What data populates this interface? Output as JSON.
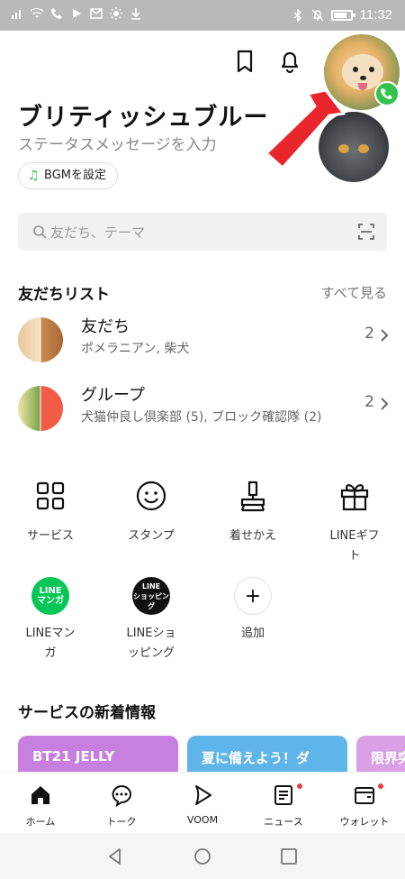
{
  "status_bar": {
    "time": "11:32",
    "battery_level": 0.8
  },
  "profile": {
    "name": "ブリティッシュブルー",
    "status_message": "ステータスメッセージを入力",
    "bgm_label": "BGMを設定"
  },
  "search": {
    "placeholder": "友だち、テーマ"
  },
  "friends_section": {
    "title": "友だちリスト",
    "see_all": "すべて見る",
    "rows": [
      {
        "title": "友だち",
        "subtitle": "ポメラニアン, 柴犬",
        "count": "2"
      },
      {
        "title": "グループ",
        "subtitle": "犬猫仲良し倶楽部 (5), ブロック確認隊 (2)",
        "count": "2"
      }
    ]
  },
  "services": {
    "row1": [
      {
        "icon": "grid-icon",
        "label": "サービス"
      },
      {
        "icon": "smiley-icon",
        "label": "スタンプ"
      },
      {
        "icon": "brush-icon",
        "label": "着せかえ"
      },
      {
        "icon": "gift-icon",
        "label": "LINEギフト"
      }
    ],
    "row2": [
      {
        "icon": "line-manga-icon",
        "badge_text": "LINE\nマンガ",
        "label": "LINEマンガ",
        "color": "#06c755"
      },
      {
        "icon": "line-shopping-icon",
        "badge_text": "LINE\nショッピング",
        "label": "LINEショッピング",
        "color": "#111111"
      },
      {
        "icon": "plus-icon",
        "label": "追加"
      }
    ]
  },
  "news": {
    "title": "サービスの新着情報",
    "cards": [
      {
        "title": "BT21 JELLY",
        "color": "#c77fe0"
      },
      {
        "title": "夏に備えよう！ダ",
        "color": "#5fb4ea"
      },
      {
        "title": "限界突",
        "color": "#d9a0e6"
      }
    ]
  },
  "tab_bar": [
    {
      "icon": "home-icon",
      "label": "ホーム",
      "active": true,
      "notify": false
    },
    {
      "icon": "chat-icon",
      "label": "トーク",
      "active": false,
      "notify": false
    },
    {
      "icon": "voom-icon",
      "label": "VOOM",
      "active": false,
      "notify": false
    },
    {
      "icon": "news-icon",
      "label": "ニュース",
      "active": false,
      "notify": true
    },
    {
      "icon": "wallet-icon",
      "label": "ウォレット",
      "active": false,
      "notify": true
    }
  ],
  "colors": {
    "accent_green": "#06c755",
    "arrow_red": "#e8262b",
    "notify_red": "#e63c43"
  }
}
